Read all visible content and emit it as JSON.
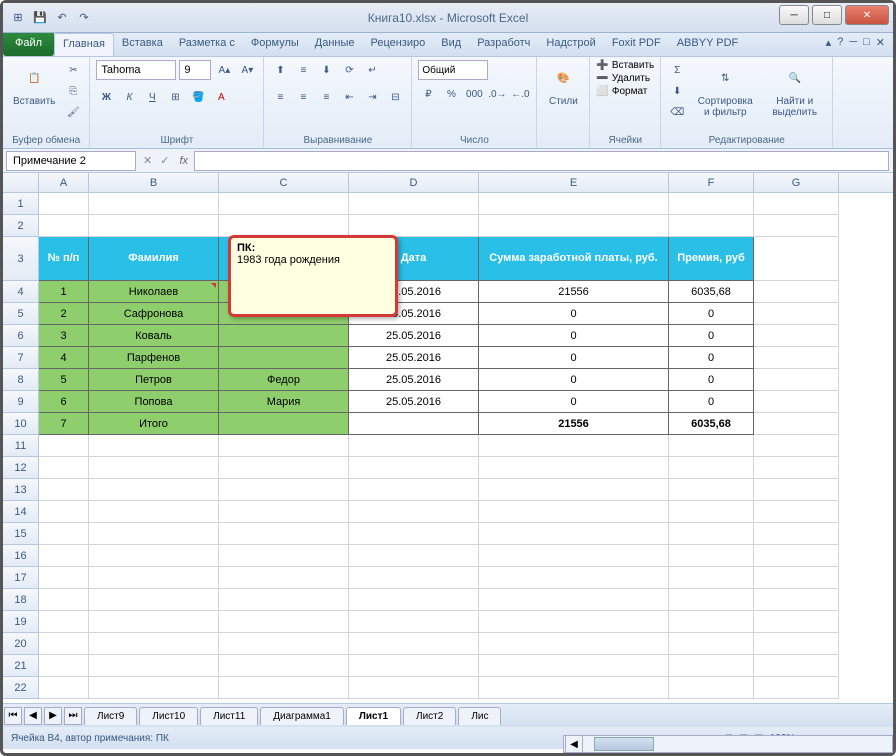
{
  "title": "Книга10.xlsx - Microsoft Excel",
  "qa": {
    "save": "💾",
    "undo": "↶",
    "redo": "↷"
  },
  "tabs": {
    "file": "Файл",
    "home": "Главная",
    "insert": "Вставка",
    "layout": "Разметка с",
    "formulas": "Формулы",
    "data": "Данные",
    "review": "Рецензиро",
    "view": "Вид",
    "dev": "Разработч",
    "addins": "Надстрой",
    "foxit": "Foxit PDF",
    "abbyy": "ABBYY PDF"
  },
  "ribbon": {
    "paste": "Вставить",
    "clipboard": "Буфер обмена",
    "font_name": "Tahoma",
    "font_size": "9",
    "font": "Шрифт",
    "align": "Выравнивание",
    "number_fmt": "Общий",
    "number": "Число",
    "styles": "Стили",
    "insert_btn": "Вставить",
    "delete_btn": "Удалить",
    "format_btn": "Формат",
    "cells": "Ячейки",
    "sort": "Сортировка и фильтр",
    "find": "Найти и выделить",
    "editing": "Редактирование"
  },
  "name_box": "Примечание 2",
  "fx_label": "fx",
  "cols": [
    "A",
    "B",
    "C",
    "D",
    "E",
    "F",
    "G"
  ],
  "headers": {
    "a": "№ п/п",
    "b": "Фамилия",
    "c": "",
    "d": "Дата",
    "e": "Сумма заработной платы, руб.",
    "f": "Премия, руб"
  },
  "rows": [
    {
      "n": "1",
      "b": "Николаев",
      "c": "",
      "d": "25.05.2016",
      "e": "21556",
      "f": "6035,68"
    },
    {
      "n": "2",
      "b": "Сафронова",
      "c": "",
      "d": "25.05.2016",
      "e": "0",
      "f": "0"
    },
    {
      "n": "3",
      "b": "Коваль",
      "c": "",
      "d": "25.05.2016",
      "e": "0",
      "f": "0"
    },
    {
      "n": "4",
      "b": "Парфенов",
      "c": "",
      "d": "25.05.2016",
      "e": "0",
      "f": "0"
    },
    {
      "n": "5",
      "b": "Петров",
      "c": "Федор",
      "d": "25.05.2016",
      "e": "0",
      "f": "0"
    },
    {
      "n": "6",
      "b": "Попова",
      "c": "Мария",
      "d": "25.05.2016",
      "e": "0",
      "f": "0"
    },
    {
      "n": "7",
      "b": "Итого",
      "c": "",
      "d": "",
      "e": "21556",
      "f": "6035,68"
    }
  ],
  "comment": {
    "author": "ПК:",
    "text": "1983 года рождения"
  },
  "sheets": {
    "s9": "Лист9",
    "s10": "Лист10",
    "s11": "Лист11",
    "diag": "Диаграмма1",
    "s1": "Лист1",
    "s2": "Лист2",
    "s3": "Лис"
  },
  "status": "Ячейка B4, автор примечания: ПК",
  "zoom": "100%"
}
